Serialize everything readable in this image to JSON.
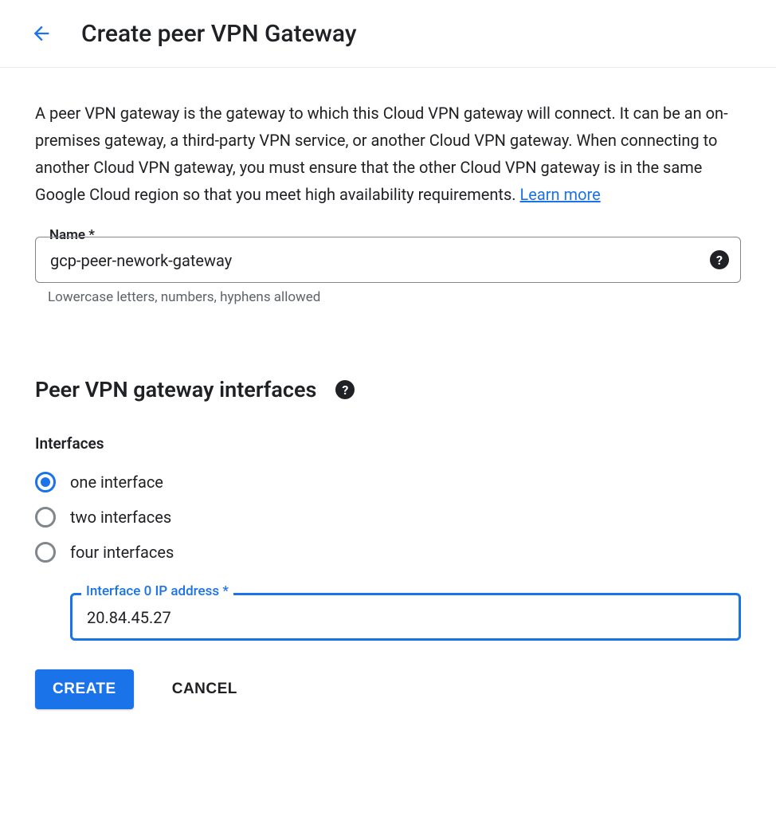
{
  "header": {
    "title": "Create peer VPN Gateway"
  },
  "description": {
    "text": "A peer VPN gateway is the gateway to which this Cloud VPN gateway will connect. It can be an on-premises gateway, a third-party VPN service, or another Cloud VPN gateway. When connecting to another Cloud VPN gateway, you must ensure that the other Cloud VPN gateway is in the same Google Cloud region so that you meet high availability requirements. ",
    "learn_more": "Learn more"
  },
  "name_field": {
    "label": "Name *",
    "value": "gcp-peer-nework-gateway",
    "helper": "Lowercase letters, numbers, hyphens allowed"
  },
  "interfaces_section": {
    "heading": "Peer VPN gateway interfaces",
    "group_label": "Interfaces",
    "options": {
      "one": "one interface",
      "two": "two interfaces",
      "four": "four interfaces"
    },
    "selected": "one",
    "ip_field": {
      "label": "Interface 0 IP address *",
      "value": "20.84.45.27"
    }
  },
  "buttons": {
    "create": "CREATE",
    "cancel": "CANCEL"
  }
}
